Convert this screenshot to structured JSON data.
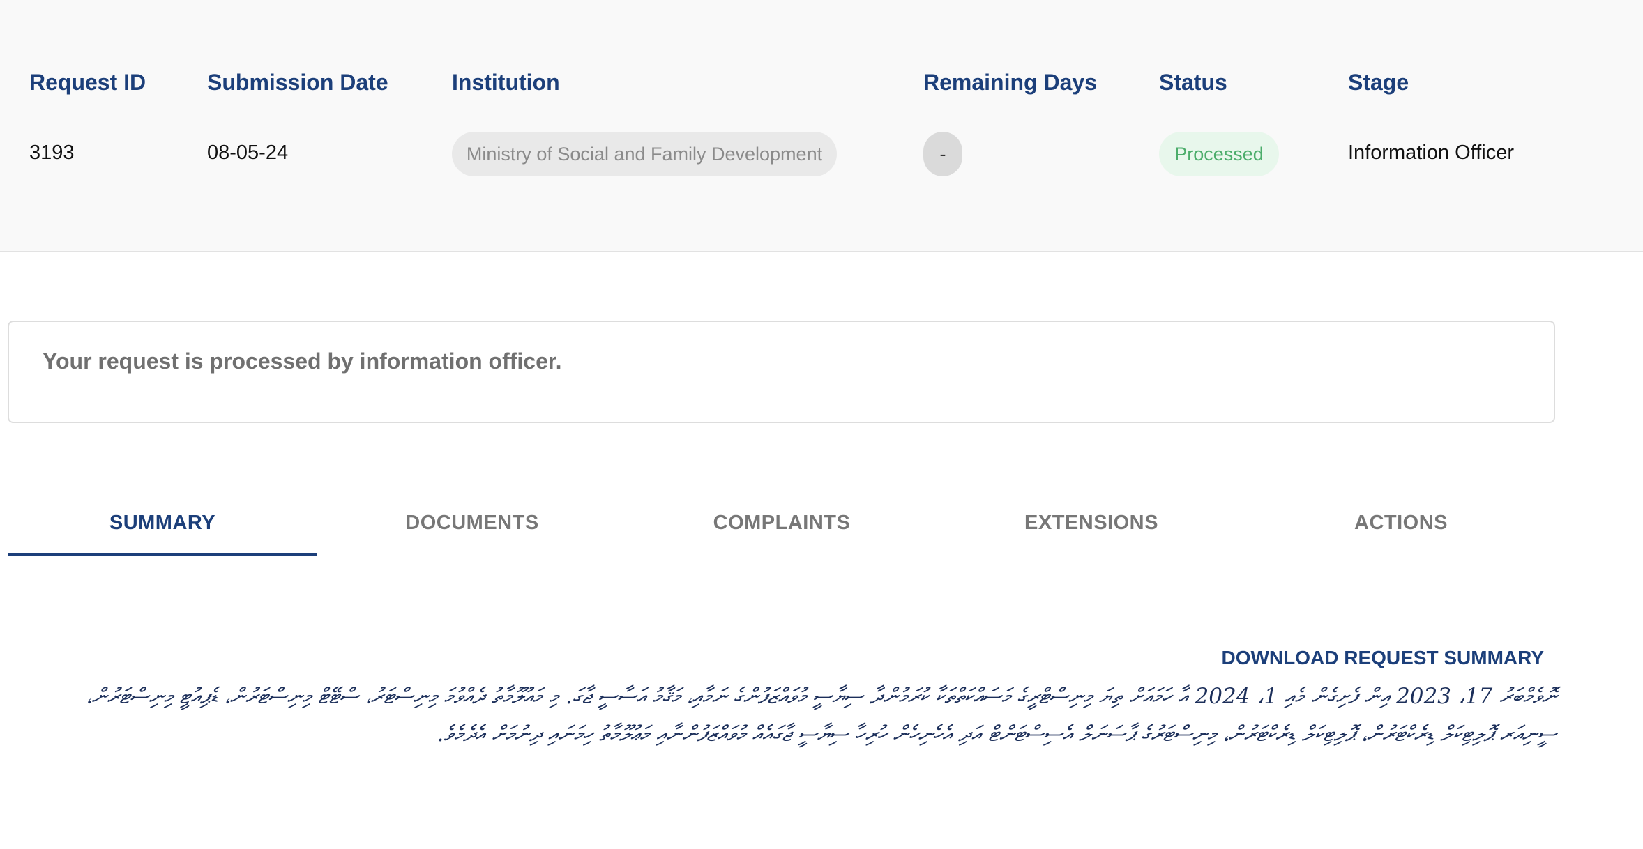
{
  "request_table": {
    "headers": {
      "request_id": "Request ID",
      "submission_date": "Submission Date",
      "institution": "Institution",
      "remaining_days": "Remaining Days",
      "status": "Status",
      "stage": "Stage"
    },
    "row": {
      "request_id": "3193",
      "submission_date": "08-05-24",
      "institution": "Ministry of Social and Family Development",
      "remaining_days": "-",
      "status": "Processed",
      "stage": "Information Officer"
    }
  },
  "message": {
    "text": "Your request is processed by information officer."
  },
  "tabs": [
    {
      "label": "SUMMARY",
      "active": true
    },
    {
      "label": "DOCUMENTS",
      "active": false
    },
    {
      "label": "COMPLAINTS",
      "active": false
    },
    {
      "label": "EXTENSIONS",
      "active": false
    },
    {
      "label": "ACTIONS",
      "active": false
    }
  ],
  "download": {
    "label": "DOWNLOAD REQUEST SUMMARY"
  },
  "summary": {
    "text": "ނޮވެމްބަރު 17، 2023 އިން ފެށިގެން މެއި 1، 2024 އާ ހަމައަށް ތިޔަ މިނިސްޓްރީގެ މަސައްކަތްތަކާ ކުރަމުންދާ ސިޔާސީ މުވައްޒަފުންގެ ނަމާއި، މަޤާމު އަސާސީ ޖާގަ. މި މައުލޫމާތު ދެއްވުމަ މިނިސްޓަރު، ސްޓޭޓް މިނިސްޓަރުން، ޑެޕިއުޓީ މިނިސްޓަރުން، ސީނިއަރ ޕޮލިޓިކަލް ޑިރެކްޓަރުން، ޕޮލިޓިކަލް ޑިރެކްޓަރުން، މިނިސްޓަރުގެ ޕާސަނަލް އެސިސްޓަންޓް އަދި އެހެނިހެން ހުރިހާ ސިޔާސީ ޖާގައެއް މުވައްޒަފުންނާއި މަޢުލޫމާތު ހިމަނައި ދިނުމަށް އެދެމެވެ."
  },
  "colors": {
    "primary": "#1c3f7a",
    "status_green": "#4cad6b",
    "status_green_bg": "#e8f7ec",
    "panel_bg": "#f9f9f9"
  }
}
